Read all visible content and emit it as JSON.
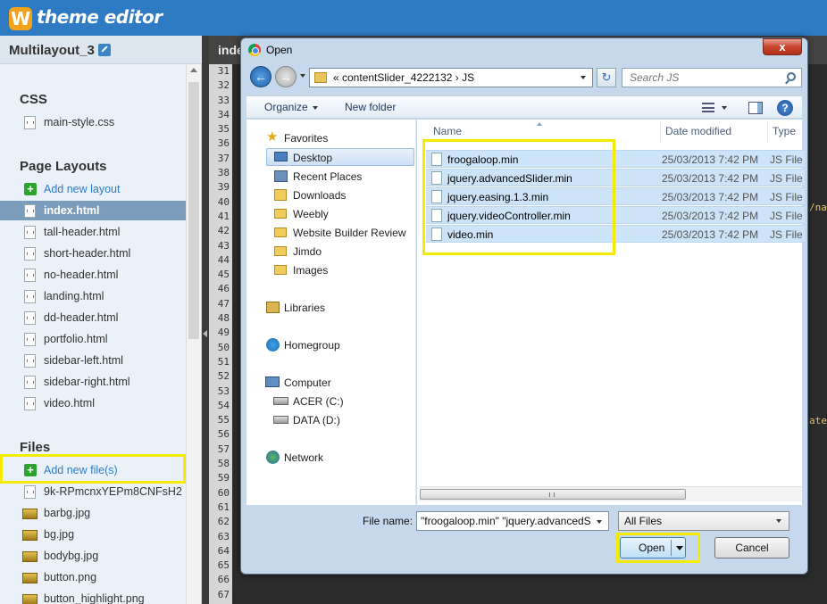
{
  "app": {
    "logo_letter": "W",
    "title": "theme editor",
    "accent_color": "#2e7bc4"
  },
  "sidebar": {
    "site_name": "Multilayout_3",
    "css_heading": "CSS",
    "css_files": [
      "main-style.css"
    ],
    "layouts_heading": "Page Layouts",
    "add_layout_label": "Add new layout",
    "layouts": [
      "index.html",
      "tall-header.html",
      "short-header.html",
      "no-header.html",
      "landing.html",
      "dd-header.html",
      "portfolio.html",
      "sidebar-left.html",
      "sidebar-right.html",
      "video.html"
    ],
    "active_layout": "index.html",
    "files_heading": "Files",
    "add_file_label": "Add new file(s)",
    "files": [
      "9k-RPmcnxYEPm8CNFsH2",
      "barbg.jpg",
      "bg.jpg",
      "bodybg.jpg",
      "button.png",
      "button_highlight.png"
    ]
  },
  "editor": {
    "tab_label": "inde",
    "line_numbers": [
      "31",
      "32",
      "33",
      "34",
      "35",
      "36",
      "37",
      "38",
      "39",
      "40",
      "41",
      "42",
      "43",
      "44",
      "45",
      "46",
      "47",
      "48",
      "49",
      "50",
      "51",
      "52",
      "53",
      "54",
      "55",
      "56",
      "57",
      "58",
      "59",
      "60",
      "61",
      "62",
      "63",
      "64",
      "65",
      "66",
      "67"
    ],
    "snippet_1": "/na",
    "snippet_2": "ate"
  },
  "dialog": {
    "title": "Open",
    "close_label": "x",
    "address_path": "«  contentSlider_4222132  ›  JS",
    "search_placeholder": "Search JS",
    "toolbar": {
      "organize": "Organize",
      "new_folder": "New folder"
    },
    "nav": {
      "favorites": "Favorites",
      "favorite_items": [
        "Desktop",
        "Recent Places",
        "Downloads",
        "Weebly",
        "Website Builder Review",
        "Jimdo",
        "Images"
      ],
      "selected": "Desktop",
      "libraries": "Libraries",
      "homegroup": "Homegroup",
      "computer": "Computer",
      "drives": [
        "ACER (C:)",
        "DATA (D:)"
      ],
      "network": "Network"
    },
    "columns": {
      "name": "Name",
      "date": "Date modified",
      "type": "Type"
    },
    "files": [
      {
        "name": "froogaloop.min",
        "date": "25/03/2013 7:42 PM",
        "type": "JS File"
      },
      {
        "name": "jquery.advancedSlider.min",
        "date": "25/03/2013 7:42 PM",
        "type": "JS File"
      },
      {
        "name": "jquery.easing.1.3.min",
        "date": "25/03/2013 7:42 PM",
        "type": "JS File"
      },
      {
        "name": "jquery.videoController.min",
        "date": "25/03/2013 7:42 PM",
        "type": "JS File"
      },
      {
        "name": "video.min",
        "date": "25/03/2013 7:42 PM",
        "type": "JS File"
      }
    ],
    "filename_label": "File name:",
    "filename_value": "\"froogaloop.min\" \"jquery.advancedS",
    "filter_value": "All Files",
    "open_label": "Open",
    "cancel_label": "Cancel"
  },
  "highlight_color": "#f5ea00"
}
